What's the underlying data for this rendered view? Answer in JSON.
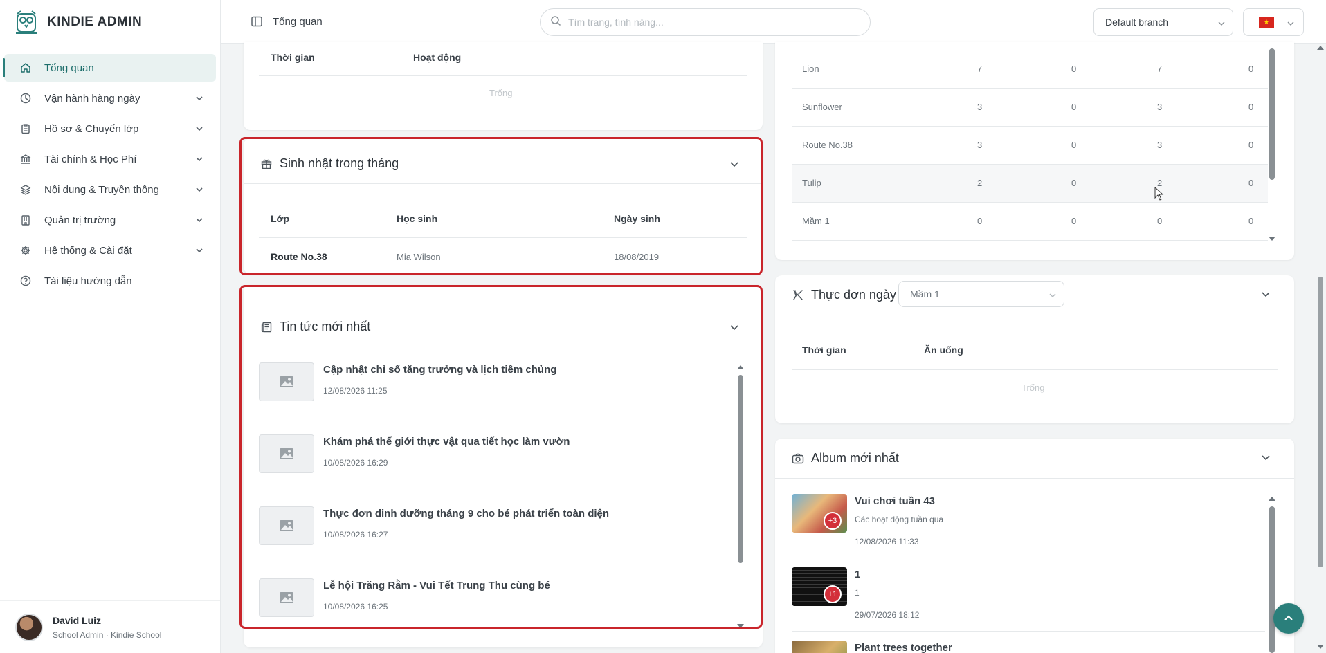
{
  "app": {
    "brand": "KINDIE ADMIN"
  },
  "sidebar": {
    "items": [
      {
        "label": "Tổng quan",
        "icon": "home-icon",
        "active": true
      },
      {
        "label": "Vận hành hàng ngày",
        "icon": "clock-icon"
      },
      {
        "label": "Hồ sơ & Chuyển lớp",
        "icon": "clipboard-icon"
      },
      {
        "label": "Tài chính & Học Phí",
        "icon": "bank-icon"
      },
      {
        "label": "Nội dung & Truyền thông",
        "icon": "layers-icon"
      },
      {
        "label": "Quản trị trường",
        "icon": "building-icon"
      },
      {
        "label": "Hệ thống & Cài đặt",
        "icon": "gear-icon"
      },
      {
        "label": "Tài liệu hướng dẫn",
        "icon": "help-icon"
      }
    ],
    "user": {
      "name": "David Luiz",
      "role": "School Admin · Kindie School"
    }
  },
  "header": {
    "title": "Tổng quan",
    "search_placeholder": "Tìm trang, tính năng...",
    "branch": "Default branch",
    "flag_star": "★"
  },
  "activity": {
    "headers": [
      "Thời gian",
      "Hoạt động"
    ],
    "empty": "Trống"
  },
  "birthdays": {
    "title": "Sinh nhật trong tháng",
    "headers": [
      "Lớp",
      "Học sinh",
      "Ngày sinh"
    ],
    "rows": [
      {
        "class": "Route No.38",
        "student": "Mia Wilson",
        "dob": "18/08/2019"
      }
    ]
  },
  "news": {
    "title": "Tin tức mới nhất",
    "items": [
      {
        "title": "Cập nhật chỉ số tăng trưởng và lịch tiêm chủng",
        "date": "12/08/2026 11:25"
      },
      {
        "title": "Khám phá thế giới thực vật qua tiết học làm vườn",
        "date": "10/08/2026 16:29"
      },
      {
        "title": "Thực đơn dinh dưỡng tháng 9 cho bé phát triển toàn diện",
        "date": "10/08/2026 16:27"
      },
      {
        "title": "Lễ hội Trăng Rằm - Vui Tết Trung Thu cùng bé",
        "date": "10/08/2026 16:25"
      }
    ]
  },
  "classes": {
    "rows": [
      {
        "name": "Lion",
        "c1": "7",
        "c2": "0",
        "c3": "7",
        "c4": "0"
      },
      {
        "name": "Sunflower",
        "c1": "3",
        "c2": "0",
        "c3": "3",
        "c4": "0"
      },
      {
        "name": "Route No.38",
        "c1": "3",
        "c2": "0",
        "c3": "3",
        "c4": "0"
      },
      {
        "name": "Tulip",
        "c1": "2",
        "c2": "0",
        "c3": "2",
        "c4": "0"
      },
      {
        "name": "Mầm 1",
        "c1": "0",
        "c2": "0",
        "c3": "0",
        "c4": "0"
      }
    ]
  },
  "menu": {
    "title": "Thực đơn ngày",
    "selected_class": "Mầm 1",
    "headers": [
      "Thời gian",
      "Ăn uống"
    ],
    "empty": "Trống"
  },
  "album": {
    "title": "Album mới nhất",
    "items": [
      {
        "title": "Vui chơi tuần 43",
        "desc": "Các hoạt động tuần qua",
        "date": "12/08/2026 11:33",
        "badge": "+3"
      },
      {
        "title": "1",
        "desc": "1",
        "date": "29/07/2026 18:12",
        "badge": "+1"
      },
      {
        "title": "Plant trees together",
        "desc": "",
        "date": "",
        "badge": ""
      }
    ]
  },
  "colors": {
    "accent": "#2a7f7b",
    "highlight": "#c9252b",
    "active_bg": "#e9f2f1"
  }
}
